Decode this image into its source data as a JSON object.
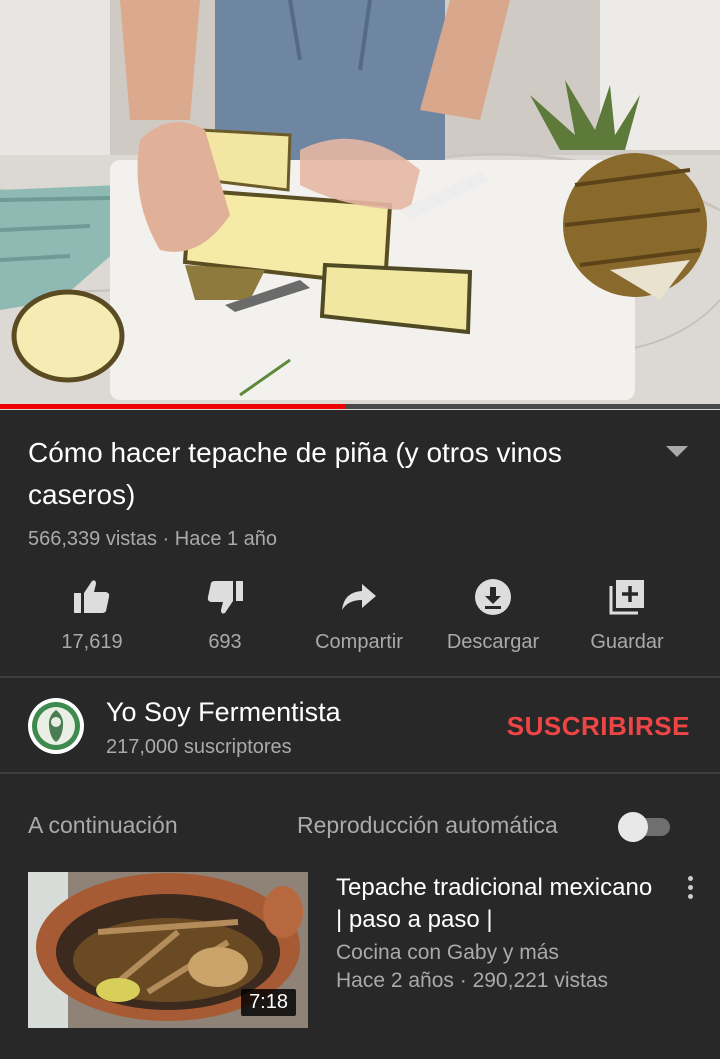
{
  "video": {
    "progress_fraction": 0.48
  },
  "details": {
    "title": "Cómo hacer tepache de piña (y otros vinos caseros)",
    "meta": "566,339 vistas · Hace 1 año"
  },
  "actions": {
    "like_count": "17,619",
    "dislike_count": "693",
    "share_label": "Compartir",
    "download_label": "Descargar",
    "save_label": "Guardar"
  },
  "channel": {
    "name": "Yo Soy Fermentista",
    "subscribers": "217,000 suscriptores",
    "subscribe_label": "SUSCRIBIRSE"
  },
  "up_next": {
    "label": "A continuación",
    "autoplay_label": "Reproducción automática",
    "autoplay_on": false
  },
  "recommendation": {
    "title": "Tepache tradicional mexicano | paso a paso |",
    "channel": "Cocina con Gaby y más",
    "meta": "Hace 2 años · 290,221 vistas",
    "duration": "7:18"
  },
  "colors": {
    "background": "#282828",
    "accent_red": "#f04545",
    "progress_red": "#ee0000"
  }
}
